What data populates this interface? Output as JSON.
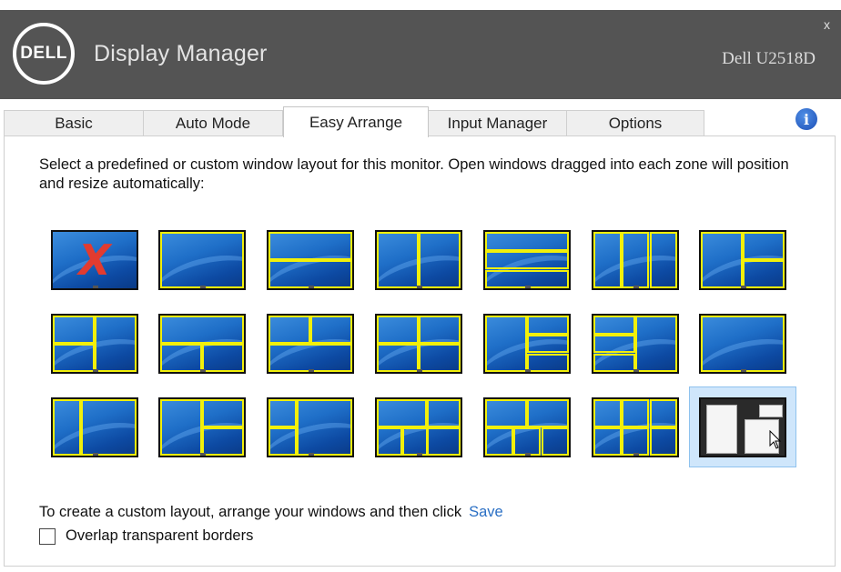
{
  "titlebar": {
    "logo_text": "DELL",
    "app_title": "Display Manager",
    "monitor_name": "Dell U2518D",
    "close_label": "x"
  },
  "tabs": [
    {
      "label": "Basic"
    },
    {
      "label": "Auto Mode"
    },
    {
      "label": "Easy Arrange",
      "active": true
    },
    {
      "label": "Input Manager"
    },
    {
      "label": "Options"
    }
  ],
  "info_icon": {
    "glyph": "i",
    "icon": "info-icon"
  },
  "description": "Select a predefined or custom window layout for this monitor.  Open windows dragged into each zone will position and resize automatically:",
  "layouts": {
    "zone_color": "#f2f00a",
    "selected": "custom",
    "items": [
      {
        "id": "none",
        "icon": "red-x-icon",
        "glyph": "X"
      },
      {
        "id": "full"
      },
      {
        "id": "2-rows"
      },
      {
        "id": "2-cols"
      },
      {
        "id": "3-rows"
      },
      {
        "id": "3-cols"
      },
      {
        "id": "left-1-right-2"
      },
      {
        "id": "left-2-right-1"
      },
      {
        "id": "top-1-bottom-2-wide"
      },
      {
        "id": "top-2-bottom-1"
      },
      {
        "id": "grid-2x2"
      },
      {
        "id": "left-1-right-3"
      },
      {
        "id": "left-3-right-1"
      },
      {
        "id": "wide-left-narrow-right"
      },
      {
        "id": "narrow-left-wide-right"
      },
      {
        "id": "left-1-right-2b"
      },
      {
        "id": "left-2-right-1b"
      },
      {
        "id": "grid-2x2-plus"
      },
      {
        "id": "top-2-bottom-3"
      },
      {
        "id": "grid-3x2"
      },
      {
        "id": "custom"
      }
    ]
  },
  "footer": {
    "custom_text": "To create a custom layout, arrange your windows and then click",
    "save_label": "Save",
    "overlap_label": "Overlap transparent borders",
    "overlap_checked": false
  }
}
